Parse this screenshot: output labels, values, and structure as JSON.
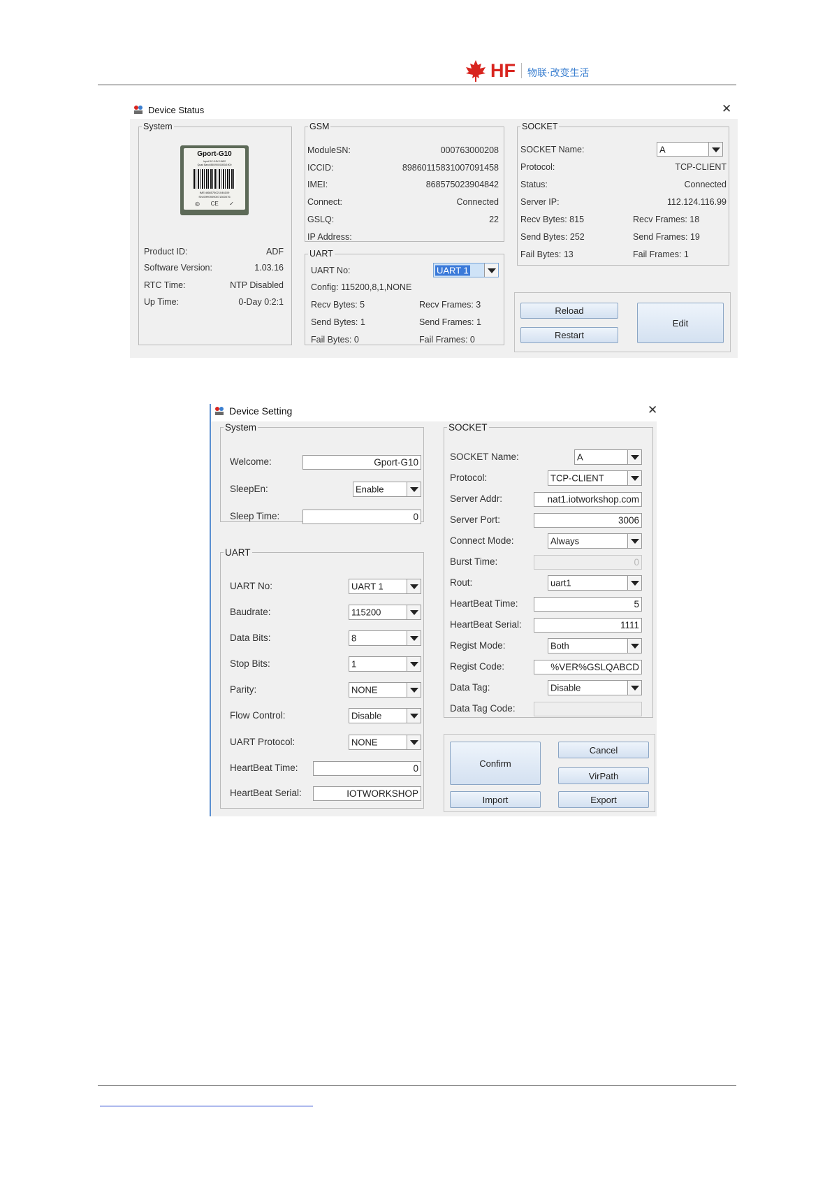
{
  "header": {
    "brand": "HF",
    "slogan": "物联·改变生活"
  },
  "status_window": {
    "title": "Device Status",
    "system": {
      "legend": "System",
      "module_image": {
        "model": "Gport-G10",
        "line1": "Input DC:3.8V 1W52",
        "line2": "Quad Band:850/900/1800/1900",
        "imei": "IMEI:868575021046109",
        "sn": "SN:09H09090071300076"
      },
      "rows": [
        {
          "label": "Product ID:",
          "value": "ADF"
        },
        {
          "label": "Software Version:",
          "value": "1.03.16"
        },
        {
          "label": "RTC Time:",
          "value": "NTP Disabled"
        },
        {
          "label": "Up Time:",
          "value": "0-Day 0:2:1"
        }
      ]
    },
    "gsm": {
      "legend": "GSM",
      "rows": [
        {
          "label": "ModuleSN:",
          "value": "000763000208"
        },
        {
          "label": "ICCID:",
          "value": "89860115831007091458"
        },
        {
          "label": "IMEI:",
          "value": "868575023904842"
        },
        {
          "label": "Connect:",
          "value": "Connected"
        },
        {
          "label": "GSLQ:",
          "value": "22"
        },
        {
          "label": "IP Address:",
          "value": ""
        }
      ]
    },
    "uart": {
      "legend": "UART",
      "uart_no_label": "UART No:",
      "uart_no_value": "UART 1",
      "config": "Config: 115200,8,1,NONE",
      "recv_bytes": "Recv Bytes: 5",
      "recv_frames": "Recv Frames: 3",
      "send_bytes": "Send Bytes: 1",
      "send_frames": "Send Frames: 1",
      "fail_bytes": "Fail Bytes: 0",
      "fail_frames": "Fail Frames: 0"
    },
    "socket": {
      "legend": "SOCKET",
      "name_label": "SOCKET Name:",
      "name_value": "A",
      "protocol_label": "Protocol:",
      "protocol_value": "TCP-CLIENT",
      "status_label": "Status:",
      "status_value": "Connected",
      "server_ip_label": "Server IP:",
      "server_ip_value": "112.124.116.99",
      "recv_bytes": "Recv Bytes: 815",
      "recv_frames": "Recv Frames: 18",
      "send_bytes": "Send Bytes: 252",
      "send_frames": "Send Frames: 19",
      "fail_bytes": "Fail Bytes: 13",
      "fail_frames": "Fail Frames: 1"
    },
    "buttons": {
      "reload": "Reload",
      "restart": "Restart",
      "edit": "Edit"
    }
  },
  "setting_window": {
    "title": "Device Setting",
    "system": {
      "legend": "System",
      "welcome_label": "Welcome:",
      "welcome_value": "Gport-G10",
      "sleepen_label": "SleepEn:",
      "sleepen_value": "Enable",
      "sleep_time_label": "Sleep Time:",
      "sleep_time_value": "0"
    },
    "uart": {
      "legend": "UART",
      "uart_no_label": "UART No:",
      "uart_no_value": "UART 1",
      "baudrate_label": "Baudrate:",
      "baudrate_value": "115200",
      "data_bits_label": "Data Bits:",
      "data_bits_value": "8",
      "stop_bits_label": "Stop Bits:",
      "stop_bits_value": "1",
      "parity_label": "Parity:",
      "parity_value": "NONE",
      "flow_label": "Flow Control:",
      "flow_value": "Disable",
      "protocol_label": "UART Protocol:",
      "protocol_value": "NONE",
      "hb_time_label": "HeartBeat Time:",
      "hb_time_value": "0",
      "hb_serial_label": "HeartBeat Serial:",
      "hb_serial_value": "IOTWORKSHOP"
    },
    "socket": {
      "legend": "SOCKET",
      "name_label": "SOCKET Name:",
      "name_value": "A",
      "protocol_label": "Protocol:",
      "protocol_value": "TCP-CLIENT",
      "addr_label": "Server Addr:",
      "addr_value": "nat1.iotworkshop.com",
      "port_label": "Server Port:",
      "port_value": "3006",
      "mode_label": "Connect Mode:",
      "mode_value": "Always",
      "burst_label": "Burst Time:",
      "burst_value": "0",
      "rout_label": "Rout:",
      "rout_value": "uart1",
      "hb_time_label": "HeartBeat Time:",
      "hb_time_value": "5",
      "hb_serial_label": "HeartBeat Serial:",
      "hb_serial_value": "1111",
      "regist_mode_label": "Regist Mode:",
      "regist_mode_value": "Both",
      "regist_code_label": "Regist Code:",
      "regist_code_value": "%VER%GSLQABCD",
      "data_tag_label": "Data Tag:",
      "data_tag_value": "Disable",
      "data_tag_code_label": "Data Tag Code:",
      "data_tag_code_value": ""
    },
    "buttons": {
      "confirm": "Confirm",
      "cancel": "Cancel",
      "virpath": "VirPath",
      "import": "Import",
      "export": "Export"
    }
  }
}
